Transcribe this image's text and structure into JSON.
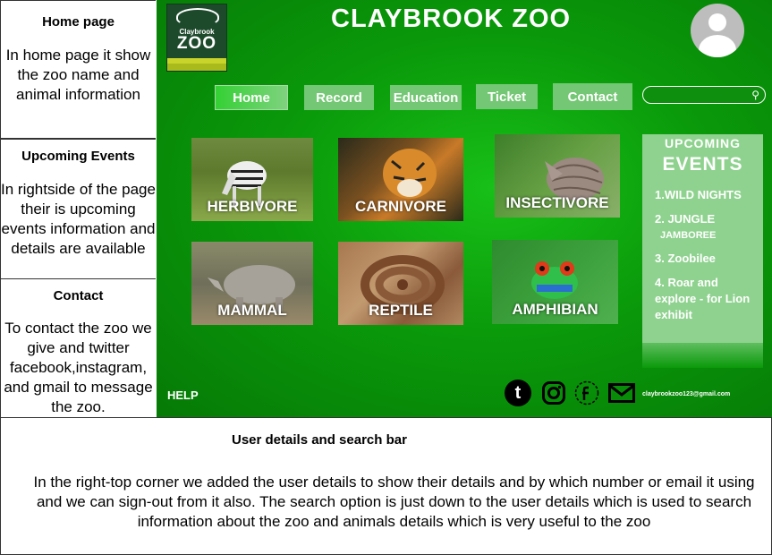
{
  "notes": {
    "home": {
      "title": "Home page",
      "text": "In home page it show the zoo name and animal information"
    },
    "events": {
      "title": "Upcoming Events",
      "text": "In rightside of the page their is upcoming events information and details are available"
    },
    "contact": {
      "title": "Contact",
      "text": "To contact the zoo we give and twitter facebook,instagram, and gmail to message the zoo."
    },
    "user": {
      "title": "User details and search bar",
      "text": "In the right-top corner we added the user details to show their details and by which number or email it using and we can sign-out from it also. The search option is just down to the user details which is used to search information about the zoo and animals details which is very useful to the zoo"
    }
  },
  "logo": {
    "small": "Claybrook",
    "big": "ZOO"
  },
  "site_title": "CLAYBROOK ZOO",
  "nav": {
    "home": "Home",
    "record": "Record",
    "education": "Education",
    "ticket": "Ticket",
    "contact": "Contact"
  },
  "search": {
    "placeholder": ""
  },
  "categories": {
    "herbivore": "HERBIVORE",
    "carnivore": "CARNIVORE",
    "insectivore": "INSECTIVORE",
    "mammal": "MAMMAL",
    "reptile": "REPTILE",
    "amphibian": "AMPHIBIAN"
  },
  "events": {
    "title_line1": "UPCOMING",
    "title_line2": "EVENTS",
    "item1": "1.WILD NIGHTS",
    "item2": "2. JUNGLE",
    "item2_sub": "JAMBOREE",
    "item3": "3. Zoobilee",
    "item4": "4. Roar and explore - for Lion exhibit"
  },
  "footer": {
    "help": "HELP",
    "email": "claybrookzoo123@gmail.com",
    "tumblr_glyph": "t"
  },
  "colors": {
    "panel_green": "#0a9a0a",
    "button_green": "#74c774",
    "events_bg": "#8fd28f"
  },
  "icons": [
    "tumblr-icon",
    "instagram-icon",
    "facebook-icon",
    "mail-icon",
    "search-icon",
    "user-avatar-icon"
  ]
}
